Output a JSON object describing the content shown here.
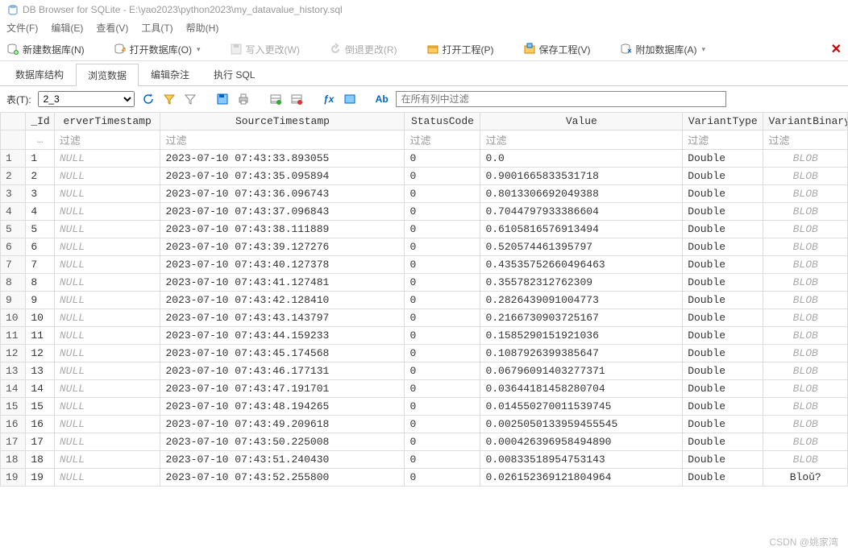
{
  "window": {
    "title": "DB Browser for SQLite - E:\\yao2023\\python2023\\my_datavalue_history.sql"
  },
  "menu": {
    "file": "文件(F)",
    "edit": "编辑(E)",
    "view": "查看(V)",
    "tools": "工具(T)",
    "help": "帮助(H)"
  },
  "toolbar": {
    "new_db": "新建数据库(N)",
    "open_db": "打开数据库(O)",
    "write_changes": "写入更改(W)",
    "revert_changes": "倒退更改(R)",
    "open_project": "打开工程(P)",
    "save_project": "保存工程(V)",
    "attach_db": "附加数据库(A)"
  },
  "tabs": {
    "structure": "数据库结构",
    "browse": "浏览数据",
    "pragmas": "编辑杂注",
    "sql": "执行 SQL"
  },
  "subbar": {
    "table_label": "表(T):",
    "selected_table": "2_3",
    "filter_all_placeholder": "在所有列中过滤"
  },
  "columns": {
    "id": "_Id",
    "server_ts": "erverTimestamp",
    "source_ts": "SourceTimestamp",
    "status": "StatusCode",
    "value": "Value",
    "vtype": "VariantType",
    "vbin": "VariantBinary"
  },
  "filter_label": "过滤",
  "filter_ellipsis": "…",
  "rows": [
    {
      "n": 1,
      "id": 1,
      "server": "NULL",
      "src": "2023-07-10 07:43:33.893055",
      "status": 0,
      "val": "0.0",
      "vtype": "Double",
      "vbin": "BLOB"
    },
    {
      "n": 2,
      "id": 2,
      "server": "NULL",
      "src": "2023-07-10 07:43:35.095894",
      "status": 0,
      "val": "0.9001665833531718",
      "vtype": "Double",
      "vbin": "BLOB"
    },
    {
      "n": 3,
      "id": 3,
      "server": "NULL",
      "src": "2023-07-10 07:43:36.096743",
      "status": 0,
      "val": "0.8013306692049388",
      "vtype": "Double",
      "vbin": "BLOB"
    },
    {
      "n": 4,
      "id": 4,
      "server": "NULL",
      "src": "2023-07-10 07:43:37.096843",
      "status": 0,
      "val": "0.7044797933386604",
      "vtype": "Double",
      "vbin": "BLOB"
    },
    {
      "n": 5,
      "id": 5,
      "server": "NULL",
      "src": "2023-07-10 07:43:38.111889",
      "status": 0,
      "val": "0.6105816576913494",
      "vtype": "Double",
      "vbin": "BLOB"
    },
    {
      "n": 6,
      "id": 6,
      "server": "NULL",
      "src": "2023-07-10 07:43:39.127276",
      "status": 0,
      "val": "0.520574461395797",
      "vtype": "Double",
      "vbin": "BLOB"
    },
    {
      "n": 7,
      "id": 7,
      "server": "NULL",
      "src": "2023-07-10 07:43:40.127378",
      "status": 0,
      "val": "0.43535752660496463",
      "vtype": "Double",
      "vbin": "BLOB"
    },
    {
      "n": 8,
      "id": 8,
      "server": "NULL",
      "src": "2023-07-10 07:43:41.127481",
      "status": 0,
      "val": "0.355782312762309",
      "vtype": "Double",
      "vbin": "BLOB"
    },
    {
      "n": 9,
      "id": 9,
      "server": "NULL",
      "src": "2023-07-10 07:43:42.128410",
      "status": 0,
      "val": "0.2826439091004773",
      "vtype": "Double",
      "vbin": "BLOB"
    },
    {
      "n": 10,
      "id": 10,
      "server": "NULL",
      "src": "2023-07-10 07:43:43.143797",
      "status": 0,
      "val": "0.2166730903725167",
      "vtype": "Double",
      "vbin": "BLOB"
    },
    {
      "n": 11,
      "id": 11,
      "server": "NULL",
      "src": "2023-07-10 07:43:44.159233",
      "status": 0,
      "val": "0.1585290151921036",
      "vtype": "Double",
      "vbin": "BLOB"
    },
    {
      "n": 12,
      "id": 12,
      "server": "NULL",
      "src": "2023-07-10 07:43:45.174568",
      "status": 0,
      "val": "0.1087926399385647",
      "vtype": "Double",
      "vbin": "BLOB"
    },
    {
      "n": 13,
      "id": 13,
      "server": "NULL",
      "src": "2023-07-10 07:43:46.177131",
      "status": 0,
      "val": "0.06796091403277371",
      "vtype": "Double",
      "vbin": "BLOB"
    },
    {
      "n": 14,
      "id": 14,
      "server": "NULL",
      "src": "2023-07-10 07:43:47.191701",
      "status": 0,
      "val": "0.03644181458280704",
      "vtype": "Double",
      "vbin": "BLOB"
    },
    {
      "n": 15,
      "id": 15,
      "server": "NULL",
      "src": "2023-07-10 07:43:48.194265",
      "status": 0,
      "val": "0.014550270011539745",
      "vtype": "Double",
      "vbin": "BLOB"
    },
    {
      "n": 16,
      "id": 16,
      "server": "NULL",
      "src": "2023-07-10 07:43:49.209618",
      "status": 0,
      "val": "0.0025050133959455545",
      "vtype": "Double",
      "vbin": "BLOB"
    },
    {
      "n": 17,
      "id": 17,
      "server": "NULL",
      "src": "2023-07-10 07:43:50.225008",
      "status": 0,
      "val": "0.000426396958494890",
      "vtype": "Double",
      "vbin": "BLOB"
    },
    {
      "n": 18,
      "id": 18,
      "server": "NULL",
      "src": "2023-07-10 07:43:51.240430",
      "status": 0,
      "val": "0.00833518954753143",
      "vtype": "Double",
      "vbin": "BLOB"
    },
    {
      "n": 19,
      "id": 19,
      "server": "NULL",
      "src": "2023-07-10 07:43:52.255800",
      "status": 0,
      "val": "0.026152369121804964",
      "vtype": "Double",
      "vbin": "Bloǔ?"
    }
  ],
  "watermark": "CSDN @姚家湾"
}
